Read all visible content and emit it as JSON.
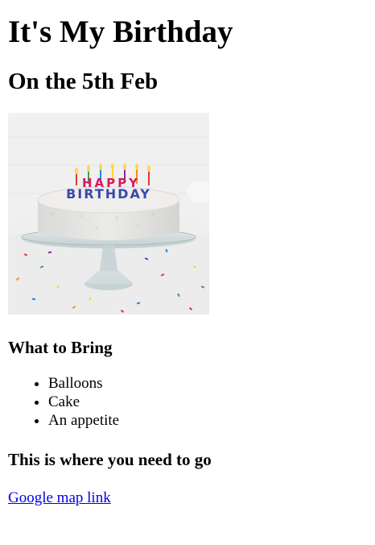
{
  "header": {
    "title": "It's My Birthday",
    "subtitle": "On the 5th Feb"
  },
  "cake_image": {
    "topper_line1": "HAPPY",
    "topper_line2": "BIRTHDAY",
    "colors": {
      "background": "#eeeeee",
      "frosting": "#e6e6e4",
      "glass": "#c9d6d8"
    }
  },
  "bring": {
    "heading": "What to Bring",
    "items": [
      "Balloons",
      "Cake",
      "An appetite"
    ]
  },
  "directions": {
    "heading": "This is where you need to go",
    "link_text": "Google map link",
    "link_color": "#0000ee"
  }
}
